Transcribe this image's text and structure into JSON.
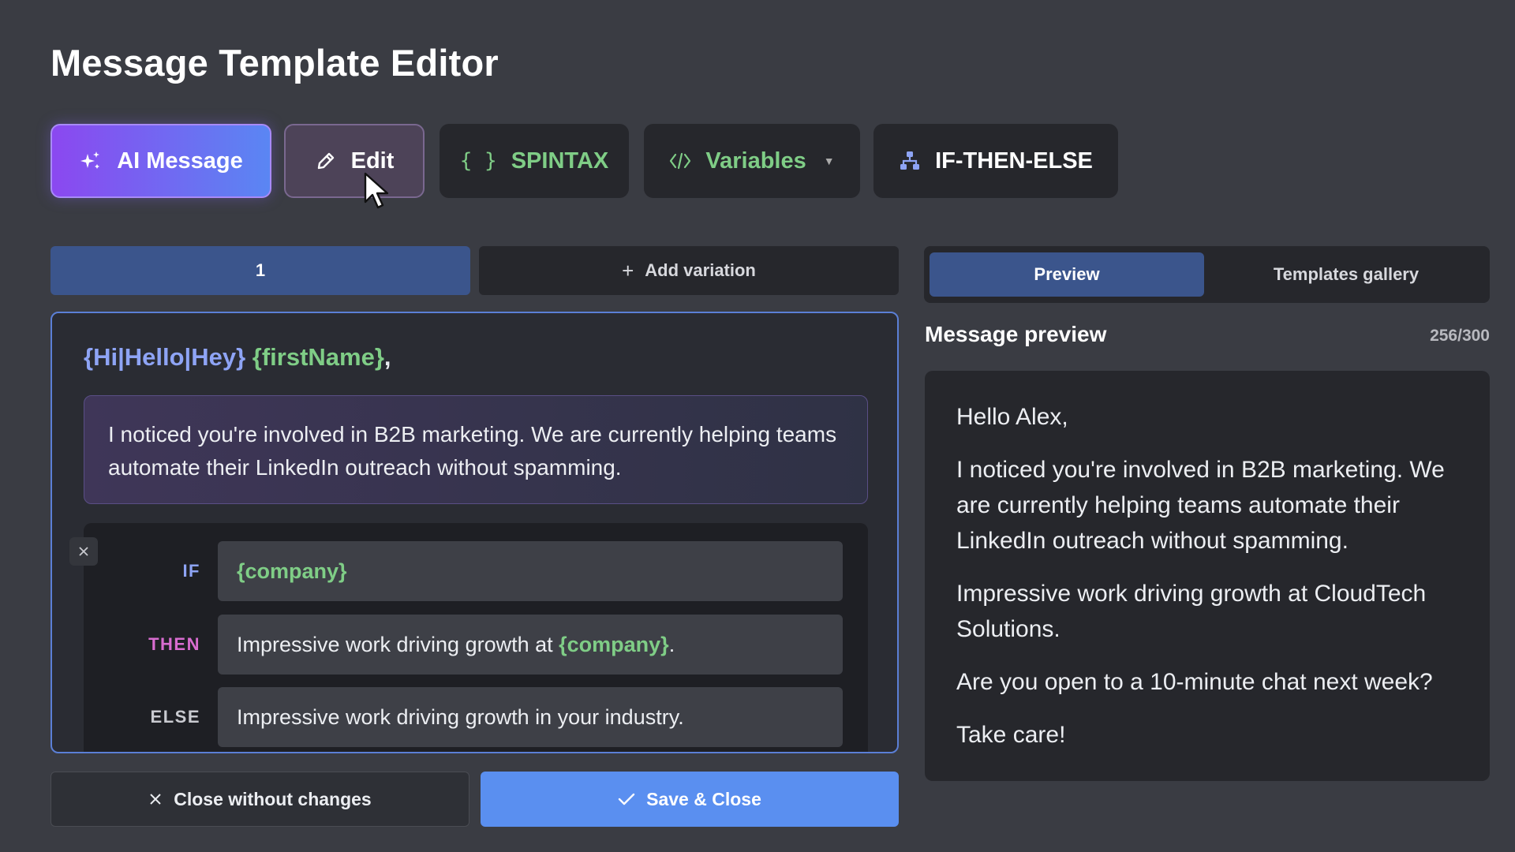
{
  "page": {
    "title": "Message Template Editor"
  },
  "toolbar": {
    "ai_message": "AI Message",
    "edit": "Edit",
    "spintax": "SPINTAX",
    "spintax_icon": "{ }",
    "variables": "Variables",
    "if_then_else": "IF-THEN-ELSE"
  },
  "variations": {
    "tab_1": "1",
    "add": "Add variation"
  },
  "editor": {
    "greeting_spintax": "{Hi|Hello|Hey}",
    "greeting_variable": "{firstName}",
    "greeting_comma": ",",
    "body": "I noticed you're involved in B2B marketing. We are currently helping teams automate their LinkedIn outreach without spamming.",
    "condition": {
      "if_label": "IF",
      "then_label": "THEN",
      "else_label": "ELSE",
      "if_value": "{company}",
      "then_prefix": "Impressive work driving growth at ",
      "then_variable": "{company}",
      "then_suffix": ".",
      "else_value": "Impressive work driving growth in your industry."
    }
  },
  "actions": {
    "close": "Close without changes",
    "save": "Save & Close"
  },
  "right_panel": {
    "tab_preview": "Preview",
    "tab_gallery": "Templates gallery",
    "preview_title": "Message preview",
    "char_count": "256/300",
    "preview_lines": [
      "Hello Alex,",
      "I noticed you're involved in B2B marketing. We are currently helping teams automate their LinkedIn outreach without spamming.",
      "Impressive work driving growth at CloudTech Solutions.",
      "Are you open to a 10-minute chat next week?",
      "Take care!"
    ]
  },
  "colors": {
    "background": "#3a3c43",
    "accent_blue": "#5a8ff0",
    "spintax": "#8ea4f5",
    "variable": "#7fcd86",
    "then_label": "#d86cd0"
  },
  "icons": {
    "ai": "sparkles-icon",
    "edit": "pencil-icon",
    "variables": "code-icon",
    "if_then_else": "hierarchy-icon",
    "add": "plus-icon",
    "close": "close-icon",
    "save": "check-icon"
  }
}
